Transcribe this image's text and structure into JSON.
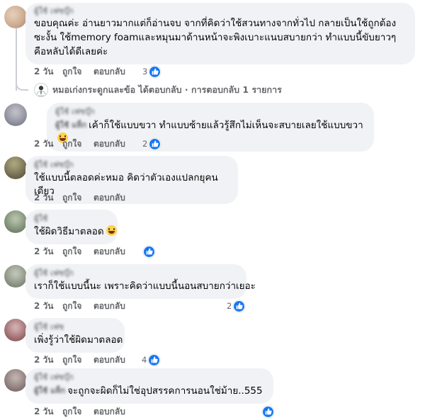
{
  "comments": [
    {
      "text": "ขอบคุณค่ะ อ่านยาวมากแต่ก็อ่านจบ จากที่คิดว่าใช้สวนทางจากทั่วไป กลายเป็นใช้ถูกต้องซะงั้น ใช้memory foamและหมุนมาด้านหน้าจะพิงเบาะแนบสบายกว่า ทำแบบนี้ขับยาวๆคือหลับได้ดีเลยค่ะ",
      "time": "2 วัน",
      "like": "ถูกใจ",
      "reply": "ตอบกลับ",
      "reactions": "3",
      "avatar_color": "#c9a88c"
    },
    {
      "text": "เค้าก็ใช้แบบขวา ทำแบบซ้ายแล้วรู้สึกไม่เห็นจะสบายเลยใช้แบบขวา",
      "time": "2 วัน",
      "like": "ถูกใจ",
      "reply": "ตอบกลับ",
      "reactions": "2",
      "avatar_color": "#8c8f9c"
    },
    {
      "text": "ใช้แบบนี้ตลอดค่ะหมอ คิดว่าตัวเองแปลกยุคนเดียว",
      "time": "2 วัน",
      "like": "ถูกใจ",
      "reply": "ตอบกลับ",
      "reactions": "",
      "avatar_color": "#6f6a4f"
    },
    {
      "text": "ใช้ผิดวิธีมาตลอด",
      "time": "2 วัน",
      "like": "ถูกใจ",
      "reply": "ตอบกลับ",
      "reactions": "",
      "avatar_color": "#7d8c74"
    },
    {
      "text": "เราก็ใช้แบบนี้นะ เพราะคิดว่าแบบนี้นอนสบายกว่าเยอะ",
      "time": "2 วัน",
      "like": "ถูกใจ",
      "reply": "ตอบกลับ",
      "reactions": "2",
      "avatar_color": "#8a9182"
    },
    {
      "text": "เพิ่งรู้ว่าใช้ผิดมาตลอด",
      "time": "2 วัน",
      "like": "ถูกใจ",
      "reply": "ตอบกลับ",
      "reactions": "4",
      "avatar_color": "#9c6a6c"
    },
    {
      "text": "จะถูกจะผิดก็ไม่ใช่อุปสรรคการนอนใช่ม้าย..555",
      "time": "2 วัน",
      "like": "ถูกใจ",
      "reply": "ตอบกลับ",
      "reactions": "",
      "avatar_color": "#8a7a78"
    }
  ],
  "reply_summary": {
    "text": "หมอเก่งกระดูกและข้อ ได้ตอบกลับ · การตอบกลับ 1 รายการ"
  },
  "colors": {
    "bubble": "#f0f2f5",
    "like_blue": "#1877f2",
    "meta_gray": "#65676b"
  },
  "icons": {
    "like": "thumbs-up-icon",
    "emoji_laugh": "grinning-face-icon",
    "emoji_tears": "tears-of-joy-icon"
  }
}
